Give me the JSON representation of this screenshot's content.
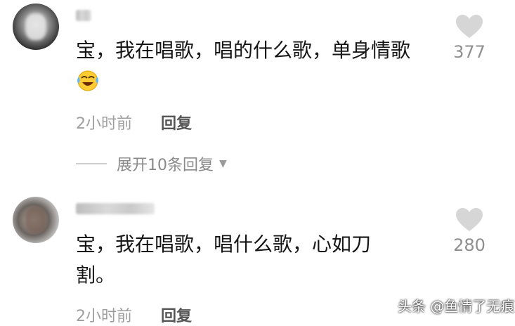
{
  "comments": [
    {
      "text": "宝，我在唱歌，唱的什么歌，单身情歌",
      "emoji": "crying-laughing-emoji",
      "time": "2小时前",
      "reply_label": "回复",
      "likes": "377",
      "expand_label": "展开10条回复"
    },
    {
      "text": "宝，我在唱歌，唱什么歌，心如刀割。",
      "time": "2小时前",
      "reply_label": "回复",
      "likes": "280"
    }
  ],
  "watermark": "头条 @鱼情了无痕",
  "icons": {
    "like": "heart-icon",
    "expand": "triangle-down-icon"
  },
  "colors": {
    "text": "#161616",
    "meta": "#9e9e9e",
    "heart": "#d6d6d6"
  }
}
